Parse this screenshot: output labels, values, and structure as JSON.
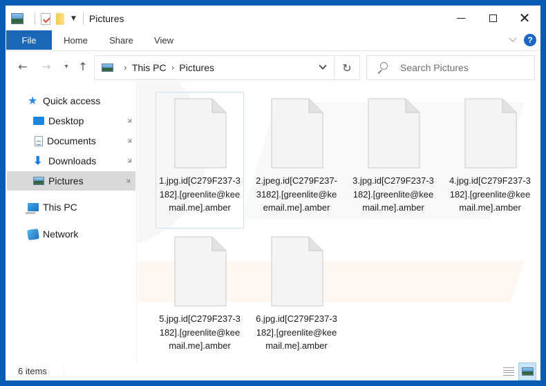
{
  "window": {
    "title": "Pictures",
    "controls": {
      "minimize": "minimize",
      "maximize": "maximize",
      "close": "close"
    }
  },
  "quick_access_toolbar": {
    "icons": [
      "pictures-folder-icon",
      "properties-icon",
      "new-folder-icon",
      "customize-dropdown-icon"
    ]
  },
  "ribbon": {
    "tabs": [
      {
        "label": "File",
        "active": true
      },
      {
        "label": "Home",
        "active": false
      },
      {
        "label": "Share",
        "active": false
      },
      {
        "label": "View",
        "active": false
      }
    ],
    "help_label": "?"
  },
  "navigation": {
    "back": "←",
    "forward": "→",
    "recent": "⌄",
    "up": "↑",
    "breadcrumb": [
      "This PC",
      "Pictures"
    ],
    "breadcrumb_sep": "›",
    "refresh": "↻",
    "search_placeholder": "Search Pictures"
  },
  "sidebar": {
    "items": [
      {
        "label": "Quick access",
        "icon": "star-icon",
        "pinned": false,
        "selected": false
      },
      {
        "label": "Desktop",
        "icon": "desktop-icon",
        "pinned": true,
        "selected": false
      },
      {
        "label": "Documents",
        "icon": "documents-icon",
        "pinned": true,
        "selected": false
      },
      {
        "label": "Downloads",
        "icon": "downloads-icon",
        "pinned": true,
        "selected": false
      },
      {
        "label": "Pictures",
        "icon": "pictures-icon",
        "pinned": true,
        "selected": true
      },
      {
        "label": "This PC",
        "icon": "computer-icon",
        "pinned": false,
        "selected": false
      },
      {
        "label": "Network",
        "icon": "network-icon",
        "pinned": false,
        "selected": false
      }
    ],
    "pin_glyph": "📌"
  },
  "files": [
    {
      "name": "1.jpg.id[C279F237-3182].[greenlite@keemail.me].amber",
      "selected": true
    },
    {
      "name": "2.jpeg.id[C279F237-3182].[greenlite@keemail.me].amber",
      "selected": false
    },
    {
      "name": "3.jpg.id[C279F237-3182].[greenlite@keemail.me].amber",
      "selected": false
    },
    {
      "name": "4.jpg.id[C279F237-3182].[greenlite@keemail.me].amber",
      "selected": false
    },
    {
      "name": "5.jpg.id[C279F237-3182].[greenlite@keemail.me].amber",
      "selected": false
    },
    {
      "name": "6.jpg.id[C279F237-3182].[greenlite@keemail.me].amber",
      "selected": false
    }
  ],
  "status": {
    "item_count": "6 items",
    "view_mode": "large-icons"
  },
  "colors": {
    "frame": "#0a5db4",
    "file_tab": "#1a67b8",
    "selection": "#d9d9d9",
    "file_selected_border": "#cde1f5",
    "view_active": "#cce4f7"
  }
}
